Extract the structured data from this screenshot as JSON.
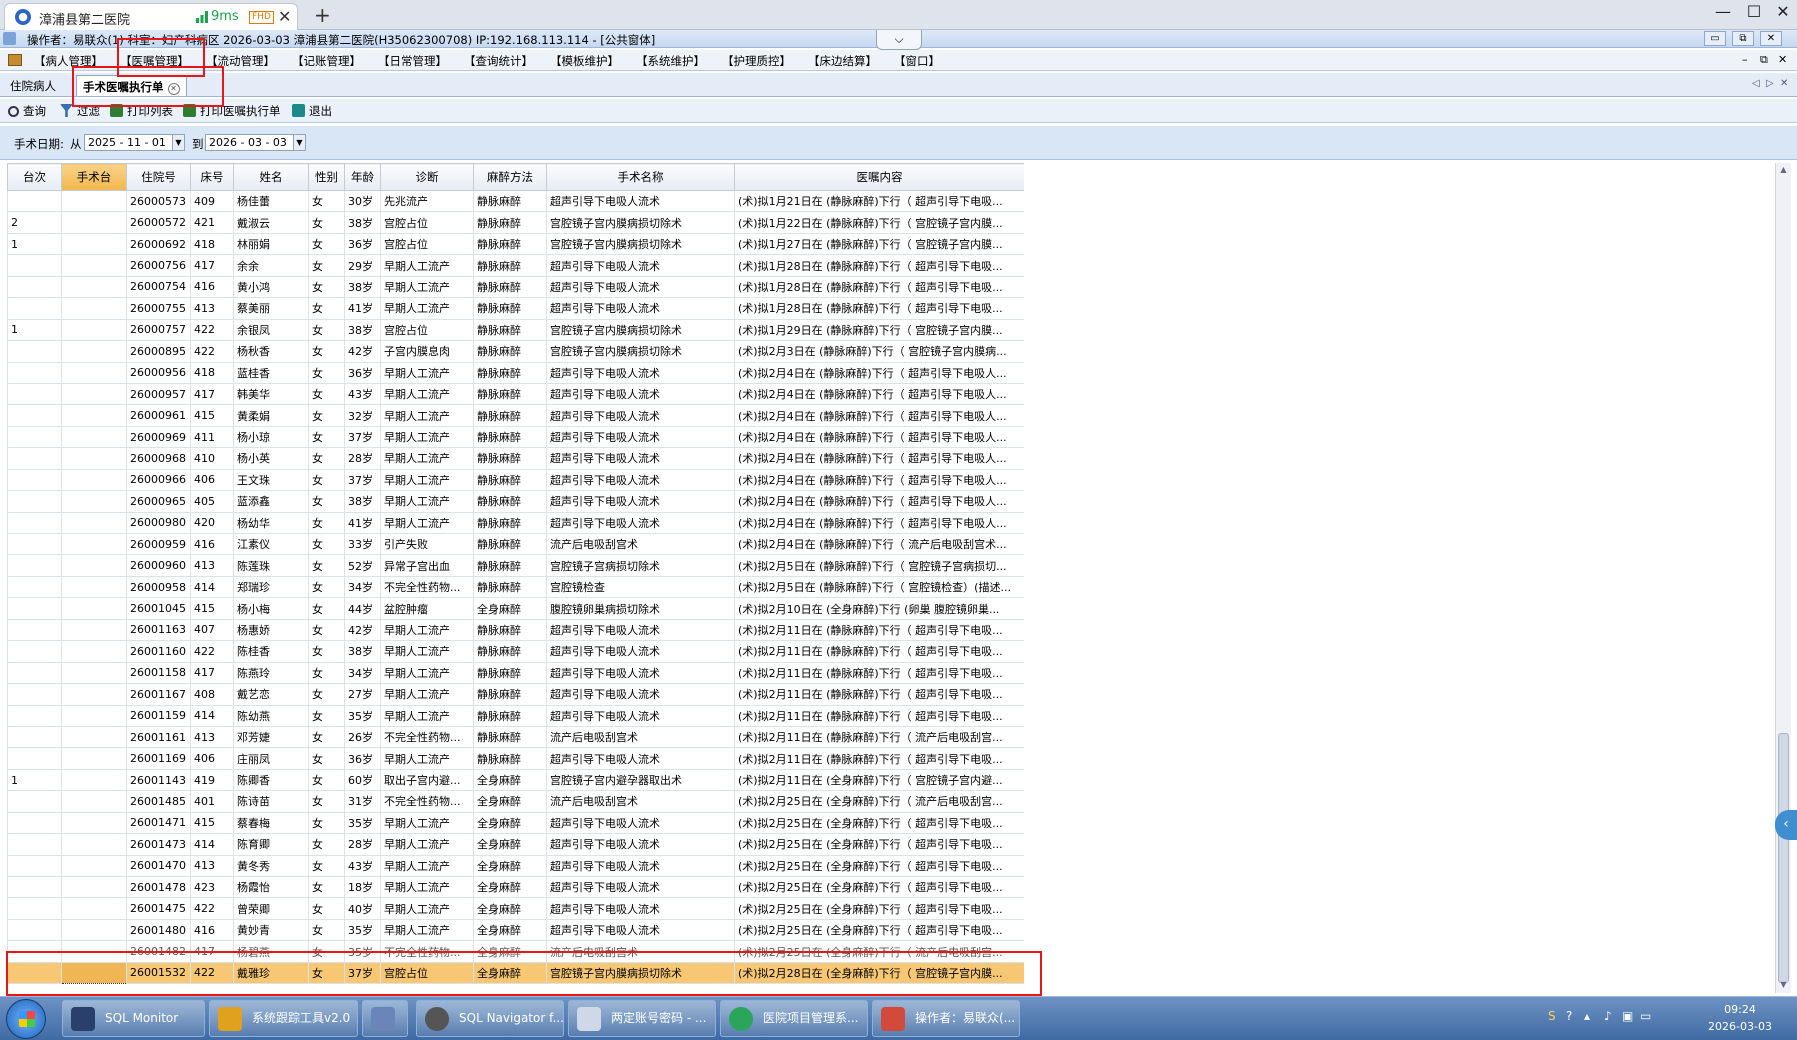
{
  "browser": {
    "tab_title": "漳浦县第二医院",
    "latency": "9ms",
    "quality_badge": "FHD",
    "close_glyph": "✕",
    "new_tab_glyph": "+",
    "window_controls": [
      "—",
      "☐",
      "✕"
    ]
  },
  "app": {
    "status_line": "操作者：易联众(1)  科室：妇产科病区  2026-03-03  漳浦县第二医院(H35062300708) IP:192.168.113.114 - [公共窗体]",
    "dropdown_glyph": "⌵",
    "mdi_controls": [
      "▭",
      "⧉",
      "✕"
    ]
  },
  "menu": {
    "items": [
      "【病人管理】",
      "【医嘱管理】",
      "【流动管理】",
      "【记账管理】",
      "【日常管理】",
      "【查询统计】",
      "【模板维护】",
      "【系统维护】",
      "【护理质控】",
      "【床边结算】",
      "【窗口】"
    ],
    "right_controls": [
      "–",
      "⧉",
      "✕"
    ]
  },
  "doc_tabs": {
    "tabs": [
      {
        "label": "住院病人",
        "active": false
      },
      {
        "label": "手术医嘱执行单",
        "active": true
      }
    ],
    "nav": [
      "◁",
      "▷",
      "✕"
    ]
  },
  "toolbar": {
    "buttons": [
      "查询",
      "过滤",
      "打印列表",
      "打印医嘱执行单",
      "退出"
    ]
  },
  "filter": {
    "label": "手术日期:",
    "from_label": "从",
    "from_date": "2025 - 11 - 01",
    "to_label": "到",
    "to_date": "2026 - 03 - 03"
  },
  "grid": {
    "columns": [
      "台次",
      "手术台",
      "住院号",
      "床号",
      "姓名",
      "性别",
      "年龄",
      "诊断",
      "麻醉方法",
      "手术名称",
      "医嘱内容"
    ],
    "rows": [
      [
        "",
        "",
        "26000573",
        "409",
        "杨佳蕾",
        "女",
        "30岁",
        "先兆流产",
        "静脉麻醉",
        "超声引导下电吸人流术",
        "(术)拟1月21日在 (静脉麻醉)下行（ 超声引导下电吸..."
      ],
      [
        "2",
        "",
        "26000572",
        "421",
        "戴淑云",
        "女",
        "38岁",
        "宫腔占位",
        "静脉麻醉",
        "宫腔镜子宫内膜病损切除术",
        "(术)拟1月22日在 (静脉麻醉)下行（ 宫腔镜子宫内膜..."
      ],
      [
        "1",
        "",
        "26000692",
        "418",
        "林丽娟",
        "女",
        "36岁",
        "宫腔占位",
        "静脉麻醉",
        "宫腔镜子宫内膜病损切除术",
        "(术)拟1月27日在 (静脉麻醉)下行（ 宫腔镜子宫内膜..."
      ],
      [
        "",
        "",
        "26000756",
        "417",
        "余余",
        "女",
        "29岁",
        "早期人工流产",
        "静脉麻醉",
        "超声引导下电吸人流术",
        "(术)拟1月28日在 (静脉麻醉)下行（ 超声引导下电吸..."
      ],
      [
        "",
        "",
        "26000754",
        "416",
        "黄小鸿",
        "女",
        "38岁",
        "早期人工流产",
        "静脉麻醉",
        "超声引导下电吸人流术",
        "(术)拟1月28日在 (静脉麻醉)下行（ 超声引导下电吸..."
      ],
      [
        "",
        "",
        "26000755",
        "413",
        "蔡美丽",
        "女",
        "41岁",
        "早期人工流产",
        "静脉麻醉",
        "超声引导下电吸人流术",
        "(术)拟1月28日在 (静脉麻醉)下行（ 超声引导下电吸..."
      ],
      [
        "1",
        "",
        "26000757",
        "422",
        "余银凤",
        "女",
        "38岁",
        "宫腔占位",
        "静脉麻醉",
        "宫腔镜子宫内膜病损切除术",
        "(术)拟1月29日在 (静脉麻醉)下行（ 宫腔镜子宫内膜..."
      ],
      [
        "",
        "",
        "26000895",
        "422",
        "杨秋香",
        "女",
        "42岁",
        "子宫内膜息肉",
        "静脉麻醉",
        "宫腔镜子宫内膜病损切除术",
        "(术)拟2月3日在 (静脉麻醉)下行（ 宫腔镜子宫内膜病..."
      ],
      [
        "",
        "",
        "26000956",
        "418",
        "蓝桂香",
        "女",
        "36岁",
        "早期人工流产",
        "静脉麻醉",
        "超声引导下电吸人流术",
        "(术)拟2月4日在 (静脉麻醉)下行（ 超声引导下电吸人..."
      ],
      [
        "",
        "",
        "26000957",
        "417",
        "韩美华",
        "女",
        "43岁",
        "早期人工流产",
        "静脉麻醉",
        "超声引导下电吸人流术",
        "(术)拟2月4日在 (静脉麻醉)下行（ 超声引导下电吸人..."
      ],
      [
        "",
        "",
        "26000961",
        "415",
        "黄柔娟",
        "女",
        "32岁",
        "早期人工流产",
        "静脉麻醉",
        "超声引导下电吸人流术",
        "(术)拟2月4日在 (静脉麻醉)下行（ 超声引导下电吸人..."
      ],
      [
        "",
        "",
        "26000969",
        "411",
        "杨小琼",
        "女",
        "37岁",
        "早期人工流产",
        "静脉麻醉",
        "超声引导下电吸人流术",
        "(术)拟2月4日在 (静脉麻醉)下行（ 超声引导下电吸人..."
      ],
      [
        "",
        "",
        "26000968",
        "410",
        "杨小英",
        "女",
        "28岁",
        "早期人工流产",
        "静脉麻醉",
        "超声引导下电吸人流术",
        "(术)拟2月4日在 (静脉麻醉)下行（ 超声引导下电吸人..."
      ],
      [
        "",
        "",
        "26000966",
        "406",
        "王文珠",
        "女",
        "37岁",
        "早期人工流产",
        "静脉麻醉",
        "超声引导下电吸人流术",
        "(术)拟2月4日在 (静脉麻醉)下行（ 超声引导下电吸人..."
      ],
      [
        "",
        "",
        "26000965",
        "405",
        "蓝添鑫",
        "女",
        "38岁",
        "早期人工流产",
        "静脉麻醉",
        "超声引导下电吸人流术",
        "(术)拟2月4日在 (静脉麻醉)下行（ 超声引导下电吸人..."
      ],
      [
        "",
        "",
        "26000980",
        "420",
        "杨幼华",
        "女",
        "41岁",
        "早期人工流产",
        "静脉麻醉",
        "超声引导下电吸人流术",
        "(术)拟2月4日在 (静脉麻醉)下行（ 超声引导下电吸人..."
      ],
      [
        "",
        "",
        "26000959",
        "416",
        "江素仪",
        "女",
        "33岁",
        "引产失败",
        "静脉麻醉",
        "流产后电吸刮宫术",
        "(术)拟2月4日在 (静脉麻醉)下行（ 流产后电吸刮宫术..."
      ],
      [
        "",
        "",
        "26000960",
        "413",
        "陈莲珠",
        "女",
        "52岁",
        "异常子宫出血",
        "静脉麻醉",
        "宫腔镜子宫病损切除术",
        "(术)拟2月5日在 (静脉麻醉)下行（ 宫腔镜子宫病损切..."
      ],
      [
        "",
        "",
        "26000958",
        "414",
        "郑瑞珍",
        "女",
        "34岁",
        "不完全性药物...",
        "静脉麻醉",
        "宫腔镜检查",
        "(术)拟2月5日在 (静脉麻醉)下行（ 宫腔镜检查）(描述..."
      ],
      [
        "",
        "",
        "26001045",
        "415",
        "杨小梅",
        "女",
        "44岁",
        "盆腔肿瘤",
        "全身麻醉",
        "腹腔镜卵巢病损切除术",
        "(术)拟2月10日在 (全身麻醉)下行 (卵巢 腹腔镜卵巢..."
      ],
      [
        "",
        "",
        "26001163",
        "407",
        "杨惠娇",
        "女",
        "42岁",
        "早期人工流产",
        "静脉麻醉",
        "超声引导下电吸人流术",
        "(术)拟2月11日在 (静脉麻醉)下行（ 超声引导下电吸..."
      ],
      [
        "",
        "",
        "26001160",
        "422",
        "陈桂香",
        "女",
        "38岁",
        "早期人工流产",
        "静脉麻醉",
        "超声引导下电吸人流术",
        "(术)拟2月11日在 (静脉麻醉)下行（ 超声引导下电吸..."
      ],
      [
        "",
        "",
        "26001158",
        "417",
        "陈燕玲",
        "女",
        "34岁",
        "早期人工流产",
        "静脉麻醉",
        "超声引导下电吸人流术",
        "(术)拟2月11日在 (静脉麻醉)下行（ 超声引导下电吸..."
      ],
      [
        "",
        "",
        "26001167",
        "408",
        "戴艺恋",
        "女",
        "27岁",
        "早期人工流产",
        "静脉麻醉",
        "超声引导下电吸人流术",
        "(术)拟2月11日在 (静脉麻醉)下行（ 超声引导下电吸..."
      ],
      [
        "",
        "",
        "26001159",
        "414",
        "陈幼燕",
        "女",
        "35岁",
        "早期人工流产",
        "静脉麻醉",
        "超声引导下电吸人流术",
        "(术)拟2月11日在 (静脉麻醉)下行（ 超声引导下电吸..."
      ],
      [
        "",
        "",
        "26001161",
        "413",
        "邓芳婕",
        "女",
        "26岁",
        "不完全性药物...",
        "静脉麻醉",
        "流产后电吸刮宫术",
        "(术)拟2月11日在 (静脉麻醉)下行（ 流产后电吸刮宫..."
      ],
      [
        "",
        "",
        "26001169",
        "406",
        "庄丽凤",
        "女",
        "36岁",
        "早期人工流产",
        "静脉麻醉",
        "超声引导下电吸人流术",
        "(术)拟2月11日在 (静脉麻醉)下行（ 超声引导下电吸..."
      ],
      [
        "1",
        "",
        "26001143",
        "419",
        "陈卿香",
        "女",
        "60岁",
        "取出子宫内避...",
        "全身麻醉",
        "宫腔镜子宫内避孕器取出术",
        "(术)拟2月11日在 (全身麻醉)下行（ 宫腔镜子宫内避..."
      ],
      [
        "",
        "",
        "26001485",
        "401",
        "陈诗苗",
        "女",
        "31岁",
        "不完全性药物...",
        "全身麻醉",
        "流产后电吸刮宫术",
        "(术)拟2月25日在 (全身麻醉)下行（ 流产后电吸刮宫..."
      ],
      [
        "",
        "",
        "26001471",
        "415",
        "蔡春梅",
        "女",
        "35岁",
        "早期人工流产",
        "全身麻醉",
        "超声引导下电吸人流术",
        "(术)拟2月25日在 (全身麻醉)下行（ 超声引导下电吸..."
      ],
      [
        "",
        "",
        "26001473",
        "414",
        "陈育卿",
        "女",
        "28岁",
        "早期人工流产",
        "全身麻醉",
        "超声引导下电吸人流术",
        "(术)拟2月25日在 (全身麻醉)下行（ 超声引导下电吸..."
      ],
      [
        "",
        "",
        "26001470",
        "413",
        "黄冬秀",
        "女",
        "43岁",
        "早期人工流产",
        "全身麻醉",
        "超声引导下电吸人流术",
        "(术)拟2月25日在 (全身麻醉)下行（ 超声引导下电吸..."
      ],
      [
        "",
        "",
        "26001478",
        "423",
        "杨霞怡",
        "女",
        "18岁",
        "早期人工流产",
        "全身麻醉",
        "超声引导下电吸人流术",
        "(术)拟2月25日在 (全身麻醉)下行（ 超声引导下电吸..."
      ],
      [
        "",
        "",
        "26001475",
        "422",
        "曾荣卿",
        "女",
        "40岁",
        "早期人工流产",
        "全身麻醉",
        "超声引导下电吸人流术",
        "(术)拟2月25日在 (全身麻醉)下行（ 超声引导下电吸..."
      ],
      [
        "",
        "",
        "26001480",
        "416",
        "黄妙青",
        "女",
        "35岁",
        "早期人工流产",
        "全身麻醉",
        "超声引导下电吸人流术",
        "(术)拟2月25日在 (全身麻醉)下行（ 超声引导下电吸..."
      ],
      [
        "",
        "",
        "26001482",
        "417",
        "杨碧燕",
        "女",
        "35岁",
        "不完全性药物...",
        "全身麻醉",
        "流产后电吸刮宫术",
        "(术)拟2月25日在 (全身麻醉)下行（ 流产后电吸刮宫..."
      ],
      [
        "",
        "",
        "26001532",
        "422",
        "戴雅珍",
        "女",
        "37岁",
        "宫腔占位",
        "全身麻醉",
        "宫腔镜子宫内膜病损切除术",
        "(术)拟2月28日在 (全身麻醉)下行（ 宫腔镜子宫内膜..."
      ]
    ]
  },
  "taskbar": {
    "tasks": [
      "SQL Monitor",
      "系统跟踪工具v2.0",
      "",
      "SQL Navigator f...",
      "两定账号密码 - ...",
      "医院项目管理系...",
      "操作者：易联众(..."
    ],
    "time": "09:24",
    "date": "2026-03-03"
  },
  "colors": {
    "selected_row": "#f7c774",
    "highlight_header": "#f1b64b",
    "annotation_red": "#e8151b"
  }
}
